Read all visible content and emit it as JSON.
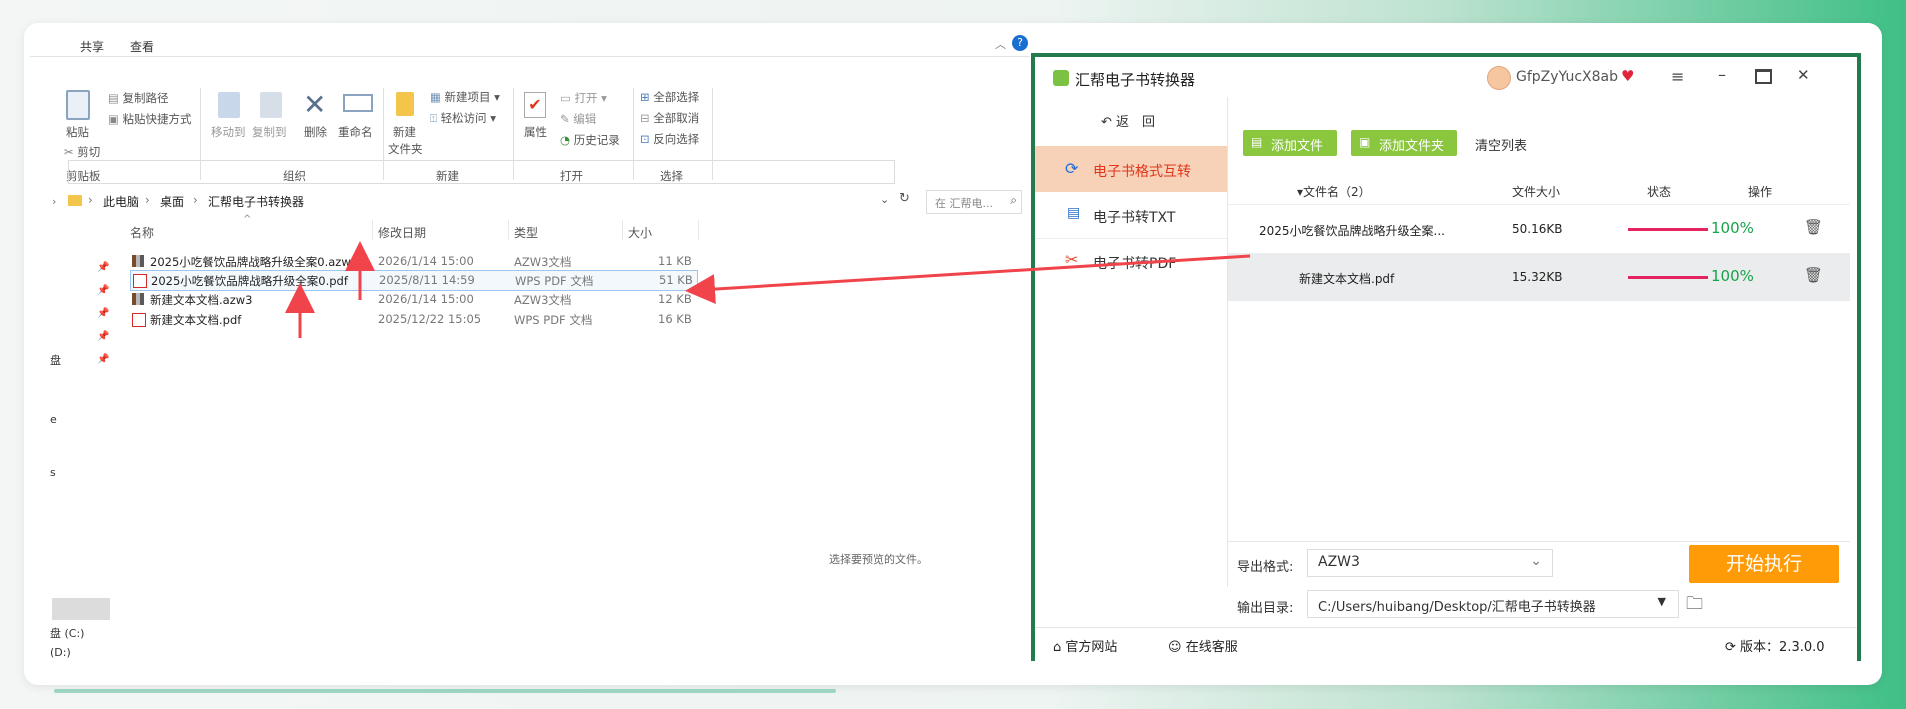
{
  "explorer": {
    "tabs": [
      "共享",
      "查看"
    ],
    "ribbon": {
      "paste": "粘贴",
      "copy_path": "复制路径",
      "paste_shortcut": "粘贴快捷方式",
      "cut": "剪切",
      "move_to": "移动到",
      "copy_to": "复制到",
      "delete": "删除",
      "rename": "重命名",
      "new_folder_line1": "新建",
      "new_folder_line2": "文件夹",
      "new_item": "新建项目",
      "easy_access": "轻松访问",
      "properties": "属性",
      "open": "打开",
      "edit": "编辑",
      "history": "历史记录",
      "select_all": "全部选择",
      "select_none": "全部取消",
      "invert_selection": "反向选择",
      "group_clipboard": "剪贴板",
      "group_organize": "组织",
      "group_new": "新建",
      "group_open": "打开",
      "group_select": "选择"
    },
    "breadcrumb": [
      "此电脑",
      "桌面",
      "汇帮电子书转换器"
    ],
    "search_placeholder": "在 汇帮电...",
    "columns": {
      "name": "名称",
      "modified": "修改日期",
      "type": "类型",
      "size": "大小"
    },
    "files": [
      {
        "name": "2025小吃餐饮品牌战略升级全案0.azw3",
        "modified": "2026/1/14 15:00",
        "type": "AZW3文档",
        "size": "11 KB",
        "icon": "azw3-icon"
      },
      {
        "name": "2025小吃餐饮品牌战略升级全案0.pdf",
        "modified": "2025/8/11 14:59",
        "type": "WPS PDF 文档",
        "size": "51 KB",
        "icon": "pdf-icon"
      },
      {
        "name": "新建文本文档.azw3",
        "modified": "2026/1/14 15:00",
        "type": "AZW3文档",
        "size": "12 KB",
        "icon": "azw3-icon"
      },
      {
        "name": "新建文本文档.pdf",
        "modified": "2025/12/22 15:05",
        "type": "WPS PDF 文档",
        "size": "16 KB",
        "icon": "pdf-icon"
      }
    ],
    "preview_hint": "选择要预览的文件。",
    "nav_partial": [
      "盘",
      "e",
      "s"
    ],
    "drives": [
      "盘 (C:)",
      "(D:)"
    ]
  },
  "app": {
    "title": "汇帮电子书转换器",
    "user": "GfpZyYucX8ab",
    "back": "返　回",
    "sidebar": [
      "电子书格式互转",
      "电子书转TXT",
      "电子书转PDF"
    ],
    "add_file": "添加文件",
    "add_folder": "添加文件夹",
    "clear_list": "清空列表",
    "headers": {
      "name": "文件名（2）",
      "size": "文件大小",
      "status": "状态",
      "action": "操作"
    },
    "rows": [
      {
        "name": "2025小吃餐饮品牌战略升级全案...",
        "size": "50.16KB",
        "progress": "100%"
      },
      {
        "name": "新建文本文档.pdf",
        "size": "15.32KB",
        "progress": "100%"
      }
    ],
    "export_format_label": "导出格式:",
    "export_format": "AZW3",
    "output_dir_label": "输出目录:",
    "output_dir": "C:/Users/huibang/Desktop/汇帮电子书转换器",
    "start": "开始执行",
    "footer": {
      "website": "官方网站",
      "support": "在线客服",
      "version": "版本：2.3.0.0"
    },
    "colors": {
      "accent_green": "#8bc63f",
      "orange": "#ff9b07",
      "progress": "#e5245f",
      "success": "#17a34a",
      "frame": "#237a4f"
    }
  }
}
